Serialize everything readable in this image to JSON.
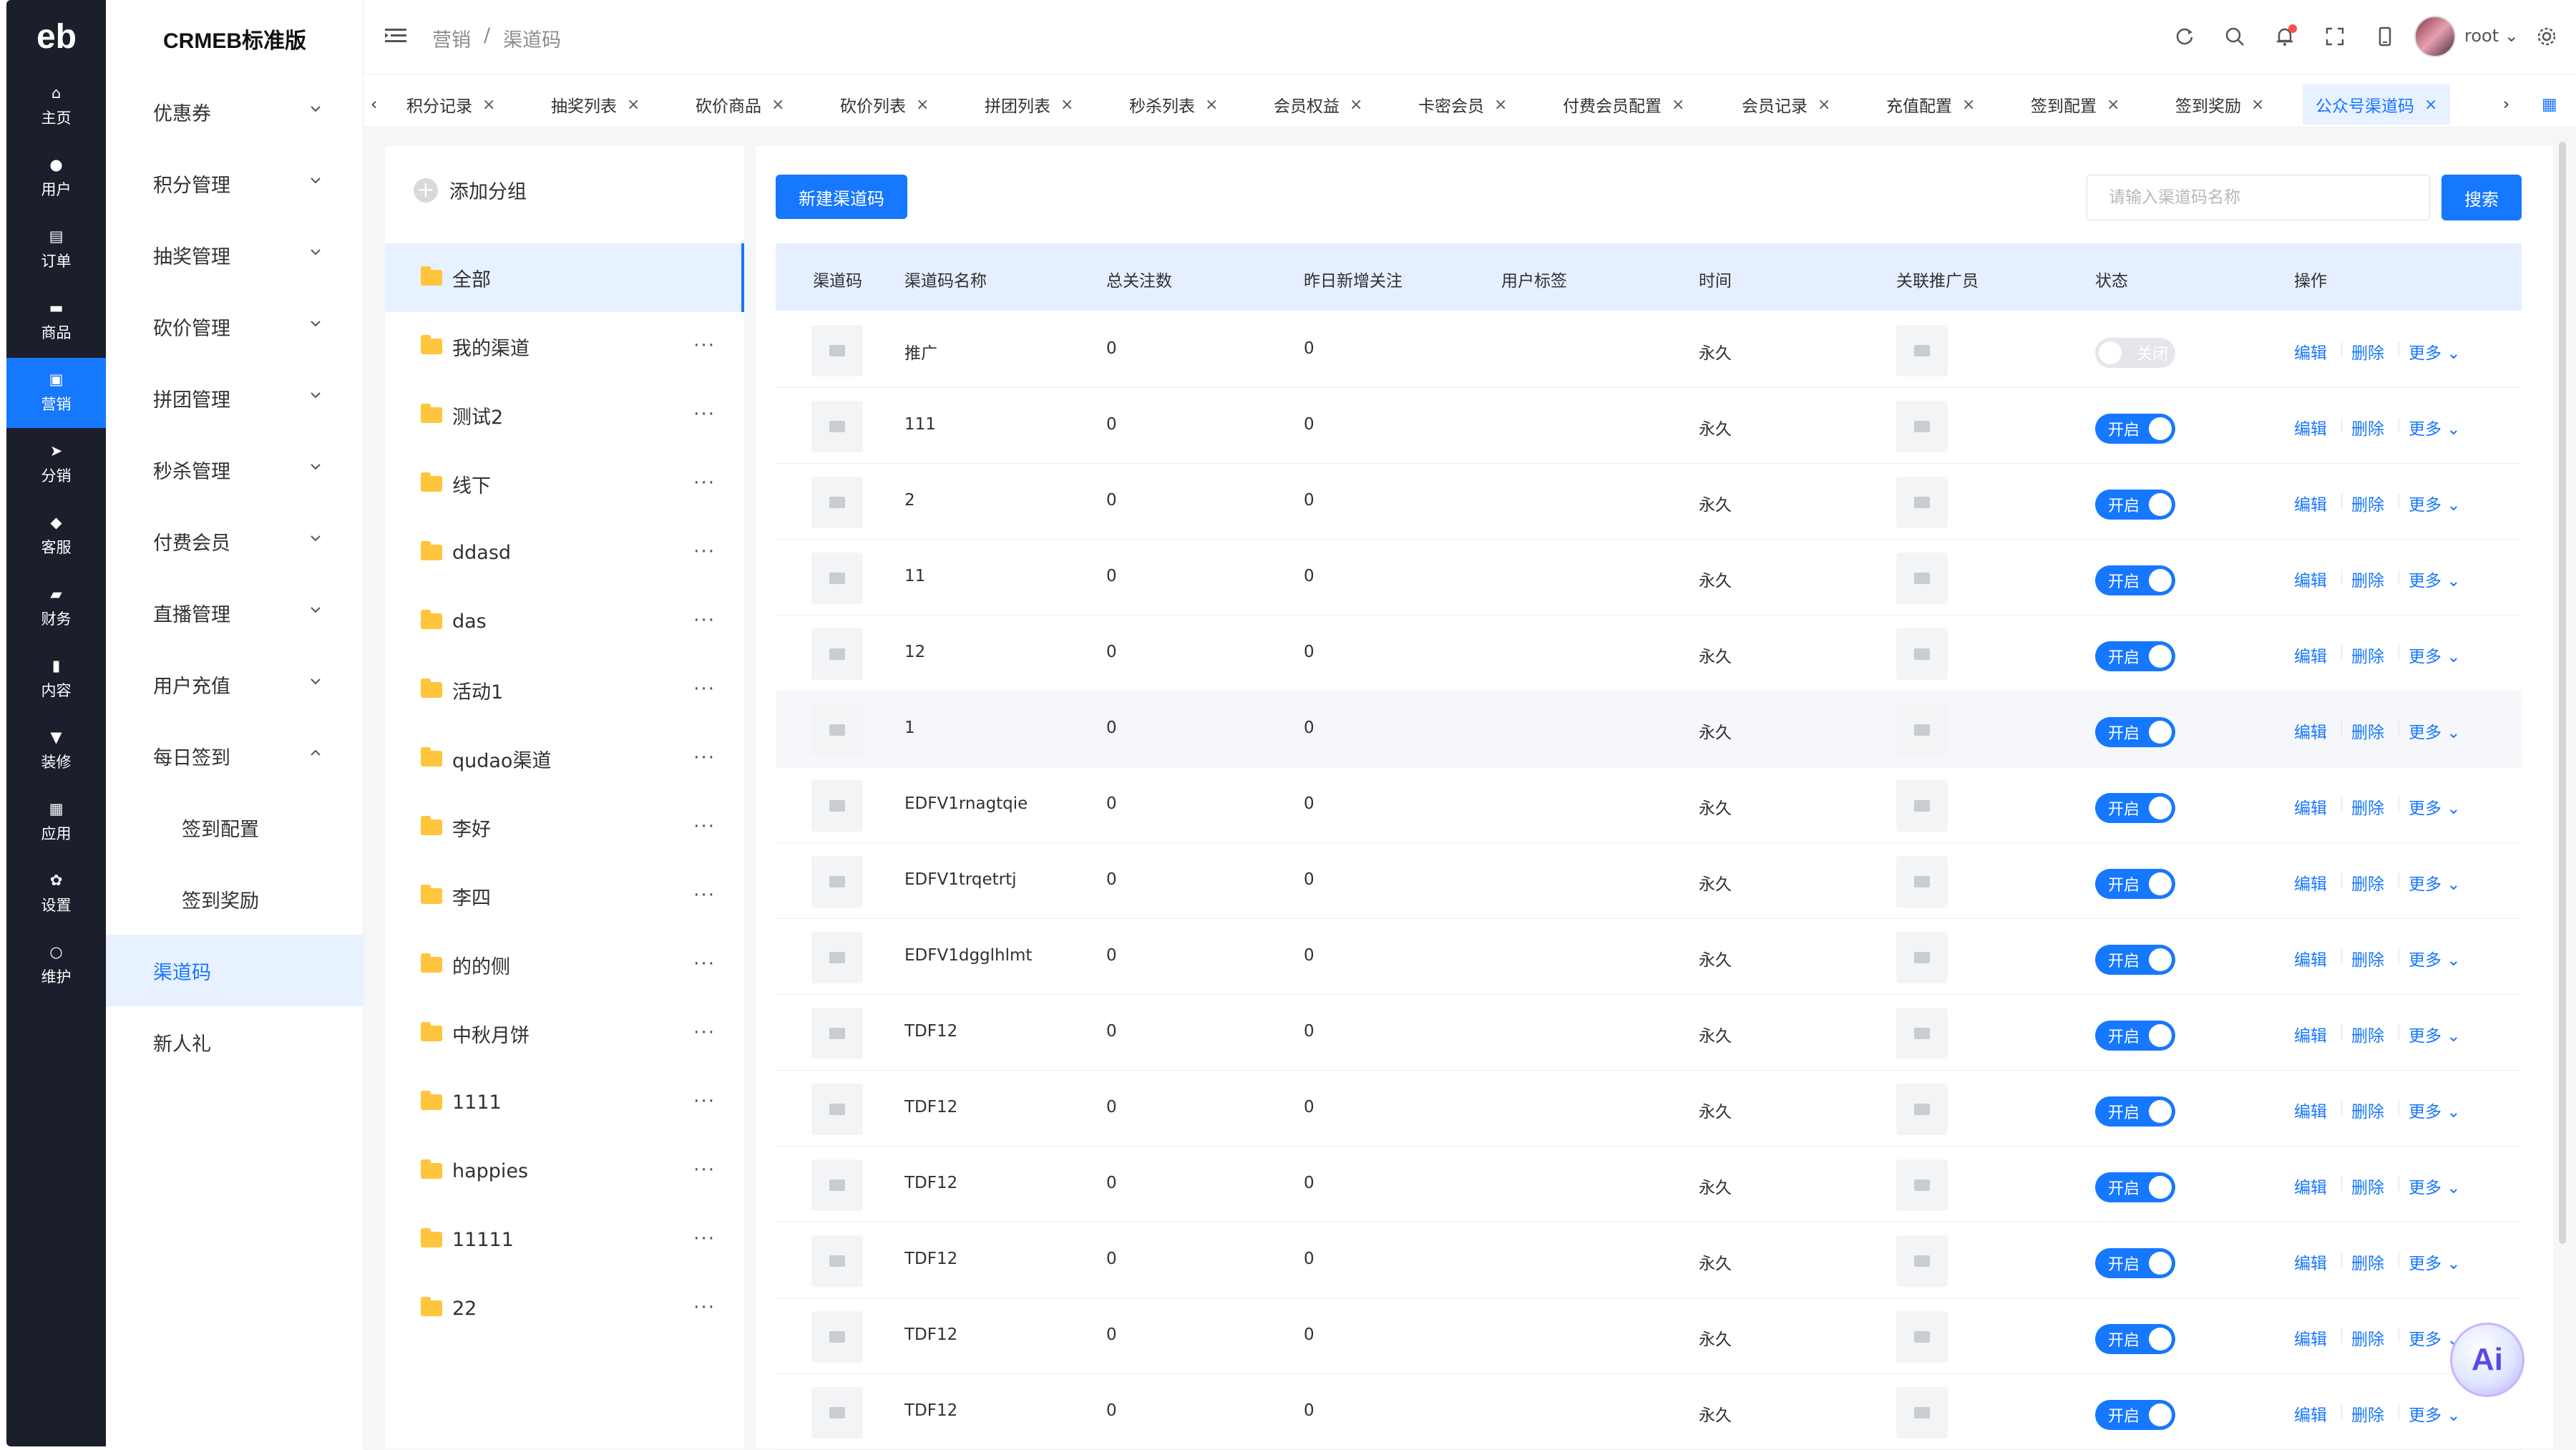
{
  "app": {
    "logo": "eb",
    "brand": "CRMEB标准版"
  },
  "rail": [
    {
      "label": "主页",
      "icon": "home-icon"
    },
    {
      "label": "用户",
      "icon": "user-icon"
    },
    {
      "label": "订单",
      "icon": "order-icon"
    },
    {
      "label": "商品",
      "icon": "product-icon"
    },
    {
      "label": "营销",
      "icon": "marketing-icon",
      "active": true
    },
    {
      "label": "分销",
      "icon": "distribution-icon"
    },
    {
      "label": "客服",
      "icon": "service-icon"
    },
    {
      "label": "财务",
      "icon": "finance-icon"
    },
    {
      "label": "内容",
      "icon": "content-icon"
    },
    {
      "label": "装修",
      "icon": "decorate-icon"
    },
    {
      "label": "应用",
      "icon": "apps-icon"
    },
    {
      "label": "设置",
      "icon": "settings-icon"
    },
    {
      "label": "维护",
      "icon": "maintain-icon"
    }
  ],
  "menu": [
    {
      "label": "优惠券",
      "chevron": "down"
    },
    {
      "label": "积分管理",
      "chevron": "down"
    },
    {
      "label": "抽奖管理",
      "chevron": "down"
    },
    {
      "label": "砍价管理",
      "chevron": "down"
    },
    {
      "label": "拼团管理",
      "chevron": "down"
    },
    {
      "label": "秒杀管理",
      "chevron": "down"
    },
    {
      "label": "付费会员",
      "chevron": "down"
    },
    {
      "label": "直播管理",
      "chevron": "down"
    },
    {
      "label": "用户充值",
      "chevron": "down"
    },
    {
      "label": "每日签到",
      "chevron": "up"
    },
    {
      "label": "签到配置",
      "sub": true
    },
    {
      "label": "签到奖励",
      "sub": true
    },
    {
      "label": "渠道码",
      "active": true
    },
    {
      "label": "新人礼"
    }
  ],
  "breadcrumb": {
    "first": "营销",
    "sep": "/",
    "current": "渠道码"
  },
  "user": {
    "name": "root"
  },
  "tabs": [
    {
      "label": "积分记录"
    },
    {
      "label": "抽奖列表"
    },
    {
      "label": "砍价商品"
    },
    {
      "label": "砍价列表"
    },
    {
      "label": "拼团列表"
    },
    {
      "label": "秒杀列表"
    },
    {
      "label": "会员权益"
    },
    {
      "label": "卡密会员"
    },
    {
      "label": "付费会员配置"
    },
    {
      "label": "会员记录"
    },
    {
      "label": "充值配置"
    },
    {
      "label": "签到配置"
    },
    {
      "label": "签到奖励"
    },
    {
      "label": "公众号渠道码",
      "active": true
    }
  ],
  "groups": {
    "add_label": "添加分组",
    "items": [
      "全部",
      "我的渠道",
      "测试2",
      "线下",
      "ddasd",
      "das",
      "活动1",
      "qudao渠道",
      "李好",
      "李四",
      "的的侧",
      "中秋月饼",
      "1111",
      "happies",
      "11111",
      "22"
    ]
  },
  "toolbar": {
    "new_label": "新建渠道码",
    "search_placeholder": "请输入渠道码名称",
    "search_label": "搜索"
  },
  "table": {
    "columns": [
      "渠道码",
      "渠道码名称",
      "总关注数",
      "昨日新增关注",
      "用户标签",
      "时间",
      "关联推广员",
      "状态",
      "操作"
    ],
    "rows": [
      {
        "name": "推广",
        "total": "0",
        "yesterday": "0",
        "time": "永久",
        "status": "关闭",
        "on": false
      },
      {
        "name": "111",
        "total": "0",
        "yesterday": "0",
        "time": "永久",
        "status": "开启",
        "on": true
      },
      {
        "name": "2",
        "total": "0",
        "yesterday": "0",
        "time": "永久",
        "status": "开启",
        "on": true
      },
      {
        "name": "11",
        "total": "0",
        "yesterday": "0",
        "time": "永久",
        "status": "开启",
        "on": true
      },
      {
        "name": "12",
        "total": "0",
        "yesterday": "0",
        "time": "永久",
        "status": "开启",
        "on": true
      },
      {
        "name": "1",
        "total": "0",
        "yesterday": "0",
        "time": "永久",
        "status": "开启",
        "on": true
      },
      {
        "name": "EDFV1rnagtqie",
        "total": "0",
        "yesterday": "0",
        "time": "永久",
        "status": "开启",
        "on": true
      },
      {
        "name": "EDFV1trqetrtj",
        "total": "0",
        "yesterday": "0",
        "time": "永久",
        "status": "开启",
        "on": true
      },
      {
        "name": "EDFV1dgglhlmt",
        "total": "0",
        "yesterday": "0",
        "time": "永久",
        "status": "开启",
        "on": true
      },
      {
        "name": "TDF12",
        "total": "0",
        "yesterday": "0",
        "time": "永久",
        "status": "开启",
        "on": true
      },
      {
        "name": "TDF12",
        "total": "0",
        "yesterday": "0",
        "time": "永久",
        "status": "开启",
        "on": true
      },
      {
        "name": "TDF12",
        "total": "0",
        "yesterday": "0",
        "time": "永久",
        "status": "开启",
        "on": true
      },
      {
        "name": "TDF12",
        "total": "0",
        "yesterday": "0",
        "time": "永久",
        "status": "开启",
        "on": true
      },
      {
        "name": "TDF12",
        "total": "0",
        "yesterday": "0",
        "time": "永久",
        "status": "开启",
        "on": true
      },
      {
        "name": "TDF12",
        "total": "0",
        "yesterday": "0",
        "time": "永久",
        "status": "开启",
        "on": true
      }
    ],
    "actions": {
      "edit": "编辑",
      "delete": "删除",
      "more": "更多"
    }
  },
  "ai_label": "Ai",
  "colors": {
    "primary": "#1677ff",
    "rail": "#1b1f2b",
    "header_bg": "#e6efff"
  }
}
